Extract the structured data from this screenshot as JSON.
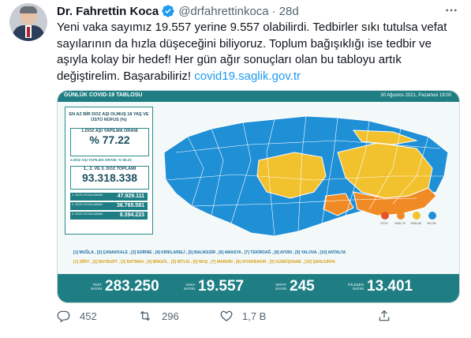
{
  "author": {
    "name": "Dr. Fahrettin Koca",
    "handle": "@drfahrettinkoca",
    "time": "28d"
  },
  "tweet": {
    "text": "Yeni vaka sayımız 19.557 yerine 9.557 olabilirdi. Tedbirler sıkı tutulsa vefat sayılarının da hızla düşeceğini biliyoruz. Toplum bağışıklığı ise tedbir ve aşıyla kolay bir hedef! Her gün ağır sonuçları olan bu tabloyu artık değiştirelim. Başarabiliriz! ",
    "link": "covid19.saglik.gov.tr"
  },
  "card": {
    "title": "GÜNLÜK COVID-19 TABLOSU",
    "date": "30 Ağustos 2021, Pazartesi 19:00",
    "panel_title": "EN AZ BİR DOZ AŞI OLMUŞ 18 YAŞ VE ÜSTÜ NÜFUS (%)",
    "first_dose_label": "1.DOZ AŞI YAPILMA ORANI",
    "first_dose_value": "% 77.22",
    "second_dose_label": "2.DOZ AŞI YAPILMA ORANI: % 59.23",
    "total_label": "1., 2. VE 3. DOZ TOPLAMI",
    "total_value": "93.318.338",
    "dose_rows": [
      {
        "label": "1. DOZ UYGULANAN",
        "value": "47.929.111"
      },
      {
        "label": "2. DOZ UYGULANAN",
        "value": "36.765.581"
      },
      {
        "label": "3. DOZ UYGULANAN",
        "value": "8.394.223"
      }
    ],
    "legend": [
      "%75+",
      "%65-75",
      "%55-65",
      "%0-55"
    ],
    "provinces_line1": "[1] MUĞLA , [2] ÇANAKKALE , [3] EDİRNE , [4] KIRKLARELİ , [5] BALIKESİR , [6] AMASYA , [7] TEKİRDAĞ , [8] AYDIN , [9] YALOVA , [10] ANTALYA",
    "provinces_line2": "[1] SİİRT , [2] BAYBURT , [3] BATMAN , [4] BİNGÖL , [5] BİTLİS , [6] MUŞ , [7] MARDİN , [8] DİYARBAKIR , [9] GÜMÜŞHANE , [10] ŞANLIURFA",
    "stats": [
      {
        "label": "TEST SAYISI",
        "value": "283.250"
      },
      {
        "label": "VAKA SAYISI",
        "value": "19.557"
      },
      {
        "label": "VEFAT SAYISI",
        "value": "245"
      },
      {
        "label": "İYİLEŞEN SAYISI",
        "value": "13.401"
      }
    ],
    "colors": {
      "teal": "#1e7e83",
      "blue": "#1f8fd6",
      "yellow": "#f2c12e",
      "orange": "#f08a24",
      "red": "#e8542a"
    }
  },
  "actions": {
    "replies": "452",
    "retweets": "296",
    "likes": "1,7 B"
  }
}
